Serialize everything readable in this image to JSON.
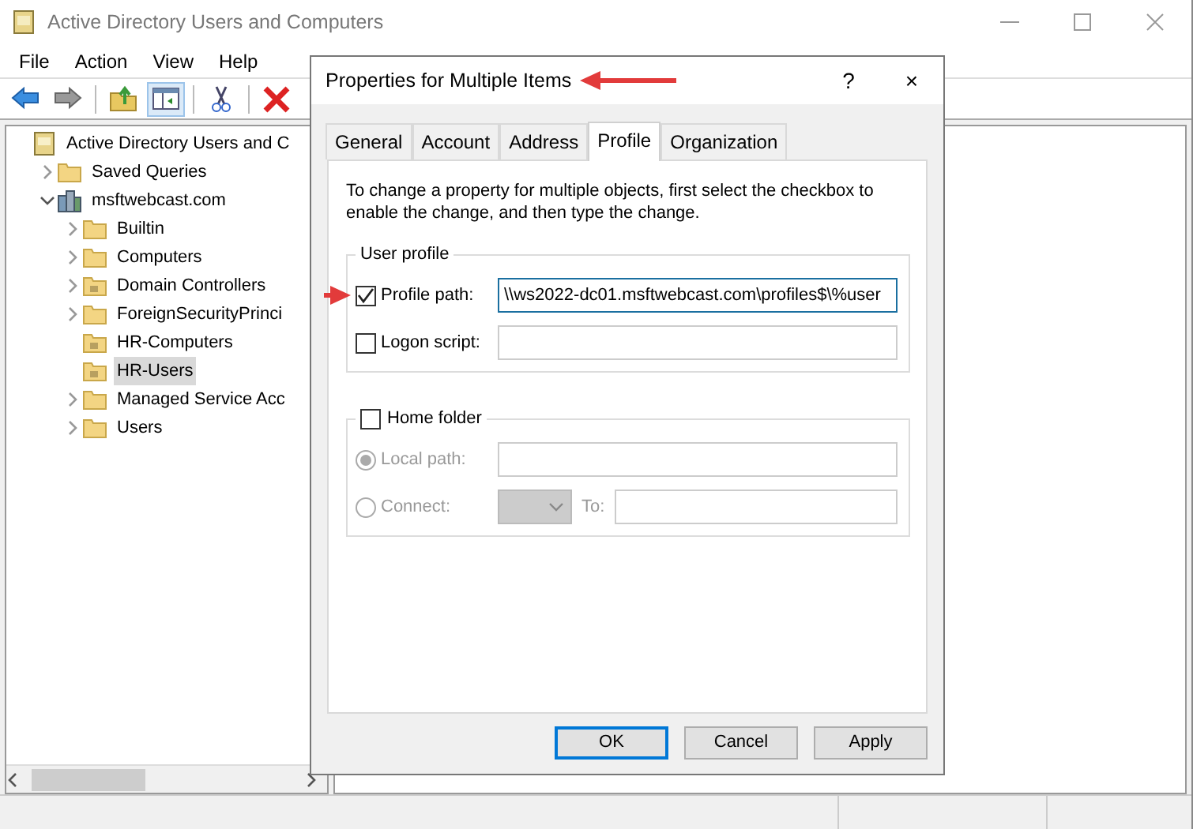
{
  "window": {
    "title": "Active Directory Users and Computers"
  },
  "menu": [
    "File",
    "Action",
    "View",
    "Help"
  ],
  "toolbar": [
    {
      "kind": "back",
      "selected": false
    },
    {
      "kind": "forward",
      "selected": false
    },
    {
      "kind": "up",
      "selected": false
    },
    {
      "kind": "tree",
      "selected": true
    },
    {
      "kind": "cut",
      "selected": false
    },
    {
      "kind": "delete",
      "selected": false
    }
  ],
  "tree": [
    {
      "label": "Active Directory Users and C",
      "kind": "root",
      "selected": false,
      "children": [
        {
          "label": "Saved Queries",
          "kind": "folder",
          "expanded": false,
          "selected": false
        },
        {
          "label": "msftwebcast.com",
          "kind": "domain",
          "expanded": true,
          "selected": false,
          "children": [
            {
              "label": "Builtin",
              "kind": "folder",
              "expanded": false,
              "selected": false
            },
            {
              "label": "Computers",
              "kind": "folder",
              "expanded": false,
              "selected": false
            },
            {
              "label": "Domain Controllers",
              "kind": "ou",
              "expanded": false,
              "selected": false
            },
            {
              "label": "ForeignSecurityPrinci",
              "kind": "folder",
              "expanded": false,
              "selected": false
            },
            {
              "label": "HR-Computers",
              "kind": "ou",
              "selected": false
            },
            {
              "label": "HR-Users",
              "kind": "ou",
              "selected": true
            },
            {
              "label": "Managed Service Acc",
              "kind": "folder",
              "expanded": false,
              "selected": false
            },
            {
              "label": "Users",
              "kind": "folder",
              "expanded": false,
              "selected": false
            }
          ]
        }
      ]
    }
  ],
  "dialog": {
    "title": "Properties for Multiple Items",
    "annotation_arrow": true,
    "help": "?",
    "close": "×",
    "tabs": [
      {
        "label": "General",
        "selected": false
      },
      {
        "label": "Account",
        "selected": false
      },
      {
        "label": "Address",
        "selected": false
      },
      {
        "label": "Profile",
        "selected": true
      },
      {
        "label": "Organization",
        "selected": false
      }
    ],
    "instruction": "To change a property for multiple objects, first select the checkbox to enable the change, and then type the change.",
    "user_profile": {
      "legend": "User profile",
      "rows": [
        {
          "kind": "checkbox",
          "label": "Profile path:",
          "checked": true,
          "value": "\\\\ws2022-dc01.msftwebcast.com\\profiles$\\%user",
          "annotation_arrow": true
        },
        {
          "kind": "checkbox",
          "label": "Logon script:",
          "checked": false,
          "annotation_arrow": false
        }
      ]
    },
    "home_folder": {
      "legend": "Home folder",
      "checked": false,
      "rows": [
        {
          "kind": "path",
          "label": "Local path:",
          "selected": true,
          "disabled": true
        },
        {
          "kind": "connect",
          "label": "Connect:",
          "selected": false,
          "disabled": true,
          "to_label": "To:"
        }
      ]
    },
    "buttons": [
      {
        "label": "OK",
        "default": true
      },
      {
        "label": "Cancel",
        "default": false
      },
      {
        "label": "Apply",
        "default": false
      }
    ]
  }
}
